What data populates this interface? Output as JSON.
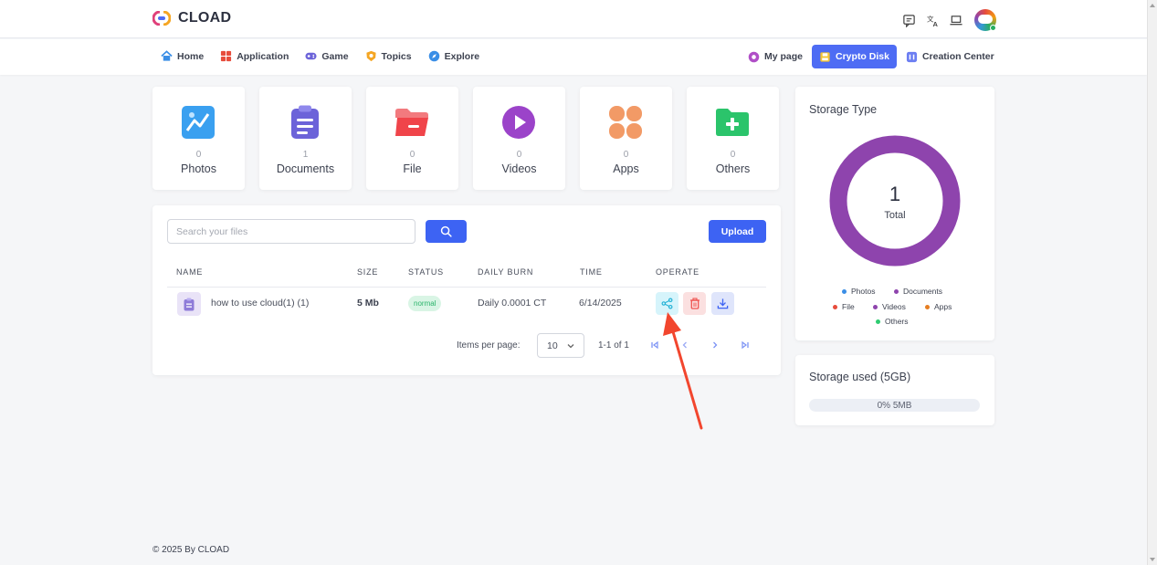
{
  "app": {
    "name": "CLOAD"
  },
  "nav": {
    "left": [
      {
        "label": "Home",
        "icon": "home-icon"
      },
      {
        "label": "Application",
        "icon": "grid-icon"
      },
      {
        "label": "Game",
        "icon": "gamepad-icon"
      },
      {
        "label": "Topics",
        "icon": "badge-icon"
      },
      {
        "label": "Explore",
        "icon": "compass-icon"
      }
    ],
    "right": [
      {
        "label": "My page",
        "icon": "flower-icon"
      },
      {
        "label": "Crypto Disk",
        "icon": "disk-icon",
        "active": true
      },
      {
        "label": "Creation Center",
        "icon": "creation-icon"
      }
    ]
  },
  "categories": [
    {
      "label": "Photos",
      "count": "0",
      "color": "#3aa0f0"
    },
    {
      "label": "Documents",
      "count": "1",
      "color": "#6c63d9"
    },
    {
      "label": "File",
      "count": "0",
      "color": "#f0444a"
    },
    {
      "label": "Videos",
      "count": "0",
      "color": "#9b43c9"
    },
    {
      "label": "Apps",
      "count": "0",
      "color": "#f29a66"
    },
    {
      "label": "Others",
      "count": "0",
      "color": "#2bc46b"
    }
  ],
  "search": {
    "placeholder": "Search your files"
  },
  "upload_label": "Upload",
  "table": {
    "headers": [
      "NAME",
      "SIZE",
      "STATUS",
      "DAILY BURN",
      "TIME",
      "OPERATE"
    ],
    "rows": [
      {
        "name": "how to use cloud(1) (1)",
        "size": "5 Mb",
        "status": "normal",
        "burn": "Daily 0.0001 CT",
        "time": "6/14/2025"
      }
    ]
  },
  "pagination": {
    "label": "Items per page:",
    "per_page": "10",
    "range": "1-1 of 1"
  },
  "storage_type": {
    "title": "Storage Type",
    "total": "1",
    "total_label": "Total",
    "legend": [
      {
        "label": "Photos",
        "color": "#3a8ee6"
      },
      {
        "label": "Documents",
        "color": "#8e44ad"
      },
      {
        "label": "File",
        "color": "#e74c3c"
      },
      {
        "label": "Videos",
        "color": "#8e44ad"
      },
      {
        "label": "Apps",
        "color": "#e67e22"
      },
      {
        "label": "Others",
        "color": "#2ecc71"
      }
    ],
    "ring_color": "#8e44ad"
  },
  "storage_used": {
    "title": "Storage used (5GB)",
    "text": "0% 5MB",
    "percent": 0
  },
  "footer": "© 2025 By CLOAD"
}
